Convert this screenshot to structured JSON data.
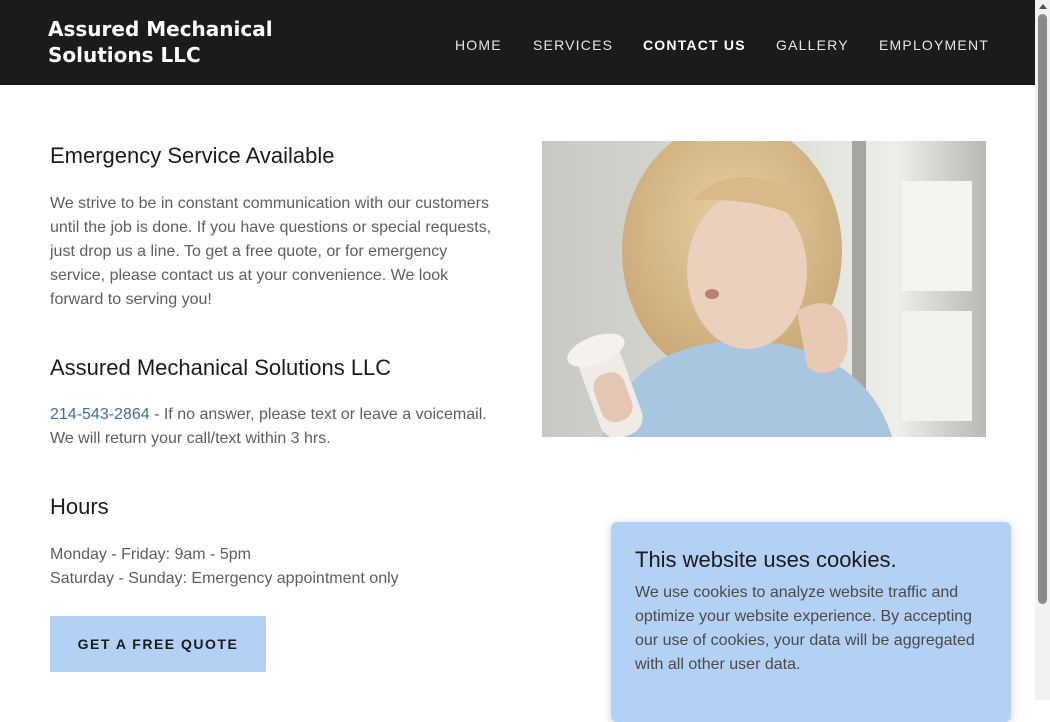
{
  "header": {
    "brand": "Assured Mechanical Solutions LLC",
    "nav": [
      {
        "label": "HOME",
        "active": false
      },
      {
        "label": "SERVICES",
        "active": false
      },
      {
        "label": "CONTACT US",
        "active": true
      },
      {
        "label": "GALLERY",
        "active": false
      },
      {
        "label": "EMPLOYMENT",
        "active": false
      }
    ]
  },
  "main": {
    "emergency": {
      "heading": "Emergency Service Available",
      "body": "We strive to be in constant communication with our customers until the job is done. If you have questions or special requests, just drop us a line. To get a free quote, or for emergency service, please contact us at your convenience. We look forward to serving you!"
    },
    "company": {
      "heading": "Assured Mechanical Solutions LLC",
      "phone": "214-543-2864",
      "phone_note": " - If no answer, please text or leave a voicemail. We will return your call/text within 3 hrs."
    },
    "hours": {
      "heading": "Hours",
      "weekday": "Monday - Friday: 9am - 5pm",
      "weekend": "Saturday - Sunday: Emergency appointment only"
    },
    "cta_label": "GET A FREE QUOTE"
  },
  "cookie_banner": {
    "title": "This website uses cookies.",
    "text": "We use cookies to analyze website traffic and optimize your website experience. By accepting our use of cookies, your data will be aggregated with all other user data."
  },
  "colors": {
    "header_bg": "#1b1b1b",
    "accent": "#b3d1f5",
    "link": "#3d6e9a"
  },
  "icons": {
    "photo": "woman-with-fan-photo",
    "scroll": "scroll-up-arrow-icon"
  }
}
